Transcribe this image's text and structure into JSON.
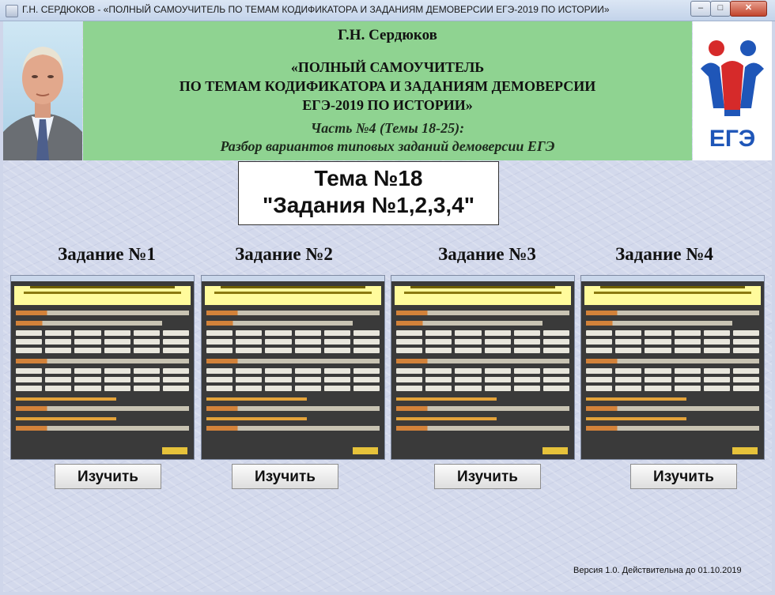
{
  "window": {
    "title": "Г.Н. СЕРДЮКОВ - «ПОЛНЫЙ САМОУЧИТЕЛЬ ПО ТЕМАМ КОДИФИКАТОРА И ЗАДАНИЯМ ДЕМОВЕРСИИ ЕГЭ-2019 ПО ИСТОРИИ»",
    "controls": {
      "minimize": "–",
      "maximize": "□",
      "close": "✕"
    }
  },
  "banner": {
    "author": "Г.Н. Сердюков",
    "title_lines": [
      "«ПОЛНЫЙ САМОУЧИТЕЛЬ",
      "ПО ТЕМАМ КОДИФИКАТОРА И ЗАДАНИЯМ ДЕМОВЕРСИИ",
      "ЕГЭ-2019 ПО ИСТОРИИ»"
    ],
    "part_lines": [
      "Часть №4 (Темы 18-25):",
      "Разбор вариантов типовых заданий демоверсии ЕГЭ"
    ],
    "logo_text": "ЕГЭ",
    "logo_colors": {
      "blue": "#1f56b8",
      "red": "#d62a2a"
    }
  },
  "theme": {
    "line1": "Тема №18",
    "line2": "\"Задания №1,2,3,4\""
  },
  "tasks": [
    {
      "title": "Задание №1",
      "button": "Изучить"
    },
    {
      "title": "Задание №2",
      "button": "Изучить"
    },
    {
      "title": "Задание №3",
      "button": "Изучить"
    },
    {
      "title": "Задание №4",
      "button": "Изучить"
    }
  ],
  "footer": {
    "version": "Версия 1.0. Действительна до 01.10.2019"
  }
}
